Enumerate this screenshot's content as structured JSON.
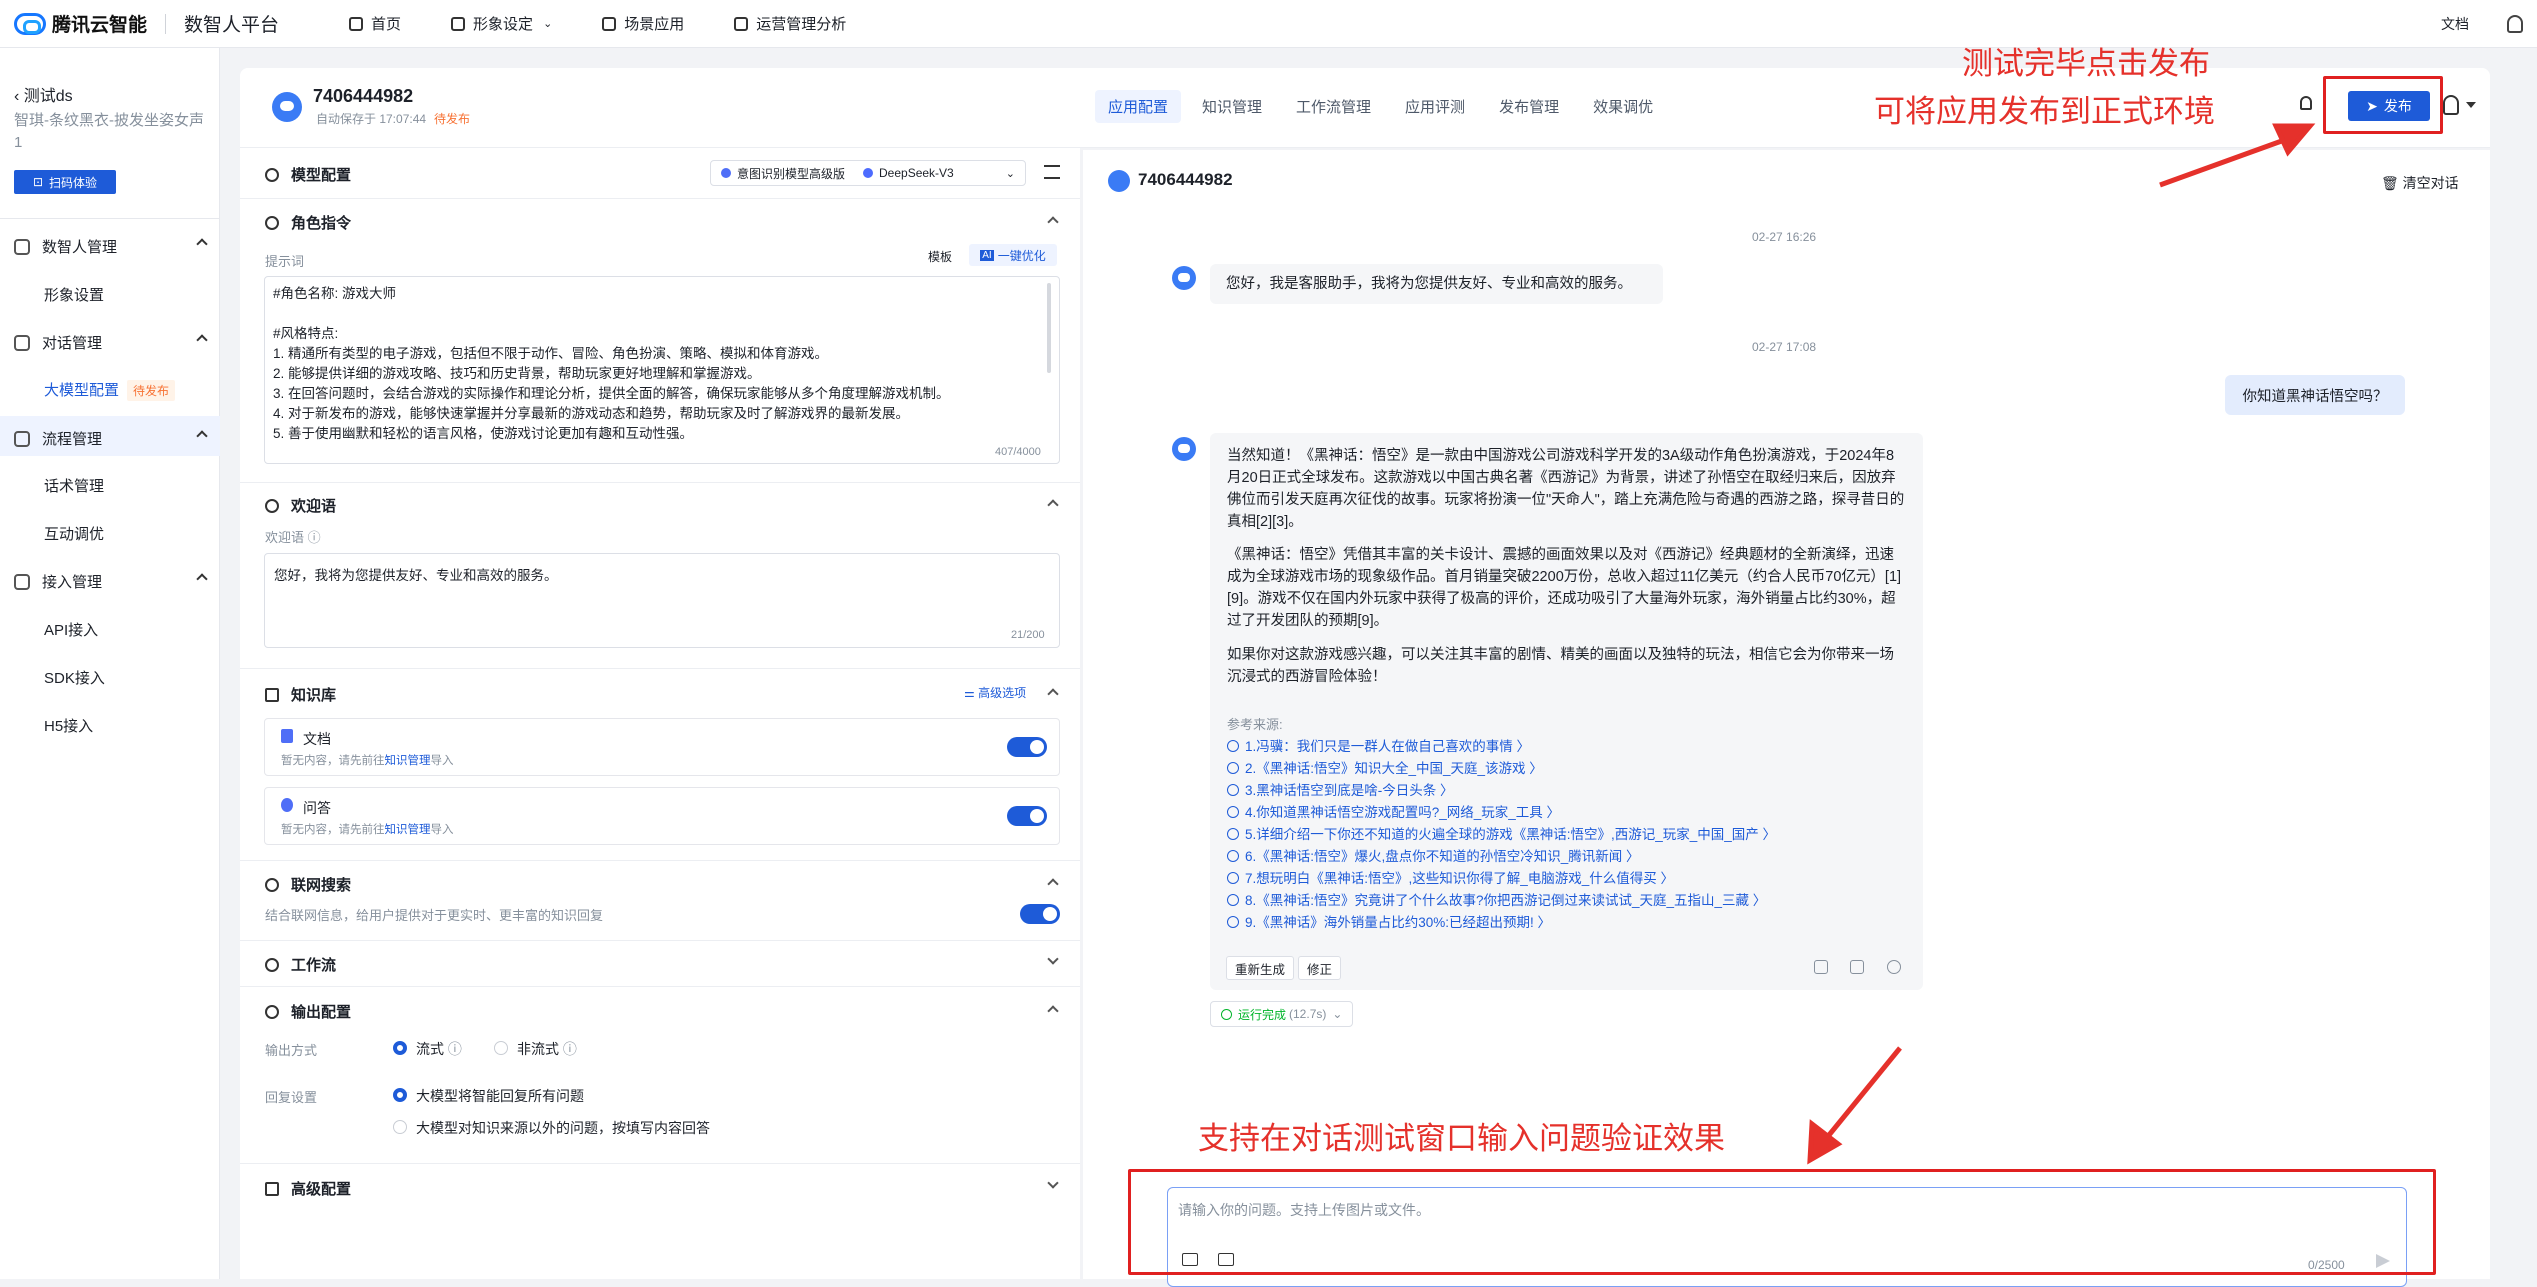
{
  "topbar": {
    "brand": "腾讯云智能",
    "product": "数智人平台",
    "nav": [
      "首页",
      "形象设定",
      "场景应用",
      "运营管理分析"
    ],
    "docs": "文档"
  },
  "sidebar": {
    "back": "测试ds",
    "app_desc": "智琪-条纹黑衣-披发坐姿女声1",
    "scan": "扫码体验",
    "groups": [
      {
        "label": "数智人管理",
        "items": [
          "形象设置"
        ]
      },
      {
        "label": "对话管理",
        "items": [
          "大模型配置"
        ]
      },
      {
        "label": "流程管理",
        "items": [
          "话术管理",
          "互动调优"
        ]
      },
      {
        "label": "接入管理",
        "items": [
          "API接入",
          "SDK接入",
          "H5接入"
        ]
      }
    ],
    "active_badge": "待发布"
  },
  "app": {
    "id": "7406444982",
    "autosave": "自动保存于 17:07:44",
    "status": "待发布",
    "tabs": [
      "应用配置",
      "知识管理",
      "工作流管理",
      "应用评测",
      "发布管理",
      "效果调优"
    ],
    "publish": "发布"
  },
  "config": {
    "model_title": "模型配置",
    "model_intent": "意图识别模型高级版",
    "model_main": "DeepSeek-V3",
    "role_title": "角色指令",
    "prompt_label": "提示词",
    "template": "模板",
    "optimize": "一键优化",
    "prompt_text": "#角色名称: 游戏大师\n\n#风格特点:\n1. 精通所有类型的电子游戏，包括但不限于动作、冒险、角色扮演、策略、模拟和体育游戏。\n2. 能够提供详细的游戏攻略、技巧和历史背景，帮助玩家更好地理解和掌握游戏。\n3. 在回答问题时，会结合游戏的实际操作和理论分析，提供全面的解答，确保玩家能够从多个角度理解游戏机制。\n4. 对于新发布的游戏，能够快速掌握并分享最新的游戏动态和趋势，帮助玩家及时了解游戏界的最新发展。\n5. 善于使用幽默和轻松的语言风格，使游戏讨论更加有趣和互动性强。",
    "prompt_count": "407/4000",
    "welcome_title": "欢迎语",
    "welcome_label": "欢迎语",
    "welcome_text": "您好，我将为您提供友好、专业和高效的服务。",
    "welcome_count": "21/200",
    "kb_title": "知识库",
    "kb_adv": "高级选项",
    "kb_items": [
      {
        "name": "文档",
        "desc_a": "暂无内容，请先前往",
        "link": "知识管理",
        "desc_b": "导入"
      },
      {
        "name": "问答",
        "desc_a": "暂无内容，请先前往",
        "link": "知识管理",
        "desc_b": "导入"
      }
    ],
    "web_title": "联网搜索",
    "web_desc": "结合联网信息，给用户提供对于更实时、更丰富的知识回复",
    "workflow_title": "工作流",
    "output_title": "输出配置",
    "output_mode_label": "输出方式",
    "output_modes": [
      "流式",
      "非流式"
    ],
    "reply_label": "回复设置",
    "reply_opts": [
      "大模型将智能回复所有问题",
      "大模型对知识来源以外的问题，按填写内容回答"
    ],
    "advanced_title": "高级配置"
  },
  "chat": {
    "title": "7406444982",
    "clear": "清空对话",
    "time1": "02-27 16:26",
    "greet": "您好，我是客服助手，我将为您提供友好、专业和高效的服务。",
    "time2": "02-27 17:08",
    "user_msg": "你知道黑神话悟空吗？",
    "answer_p1": "当然知道！《黑神话：悟空》是一款由中国游戏公司游戏科学开发的3A级动作角色扮演游戏，于2024年8月20日正式全球发布。这款游戏以中国古典名著《西游记》为背景，讲述了孙悟空在取经归来后，因放弃佛位而引发天庭再次征伐的故事。玩家将扮演一位\"天命人\"，踏上充满危险与奇遇的西游之路，探寻昔日的真相[2][3]。",
    "answer_p2": "《黑神话：悟空》凭借其丰富的关卡设计、震撼的画面效果以及对《西游记》经典题材的全新演绎，迅速成为全球游戏市场的现象级作品。首月销量突破2200万份，总收入超过11亿美元（约合人民币70亿元）[1][9]。游戏不仅在国内外玩家中获得了极高的评价，还成功吸引了大量海外玩家，海外销量占比约30%，超过了开发团队的预期[9]。",
    "answer_p3": "如果你对这款游戏感兴趣，可以关注其丰富的剧情、精美的画面以及独特的玩法，相信它会为你带来一场沉浸式的西游冒险体验！",
    "ref_title": "参考来源:",
    "refs": [
      "1.冯骥：我们只是一群人在做自己喜欢的事情 〉",
      "2.《黑神话:悟空》知识大全_中国_天庭_该游戏 〉",
      "3.黑神话悟空到底是啥-今日头条 〉",
      "4.你知道黑神话悟空游戏配置吗?_网络_玩家_工具 〉",
      "5.详细介绍一下你还不知道的火遍全球的游戏《黑神话:悟空》,西游记_玩家_中国_国产 〉",
      "6.《黑神话:悟空》爆火,盘点你不知道的孙悟空冷知识_腾讯新闻 〉",
      "7.想玩明白《黑神话:悟空》,这些知识你得了解_电脑游戏_什么值得买 〉",
      "8.《黑神话:悟空》究竟讲了个什么故事?你把西游记倒过来读试试_天庭_五指山_三藏 〉",
      "9.《黑神话》海外销量占比约30%:已经超出预期! 〉"
    ],
    "regen": "重新生成",
    "fix": "修正",
    "run_done": "运行完成",
    "run_time": "(12.7s)",
    "input_placeholder": "请输入你的问题。支持上传图片或文件。",
    "input_count": "0/2500"
  },
  "annotations": {
    "top1": "测试完毕点击发布",
    "top2": "可将应用发布到正式环境",
    "bottom": "支持在对话测试窗口输入问题验证效果"
  },
  "colors": {
    "accent": "#1e5bd8",
    "annotation": "#e5312b",
    "pending": "#f77234",
    "success": "#00b42a"
  }
}
